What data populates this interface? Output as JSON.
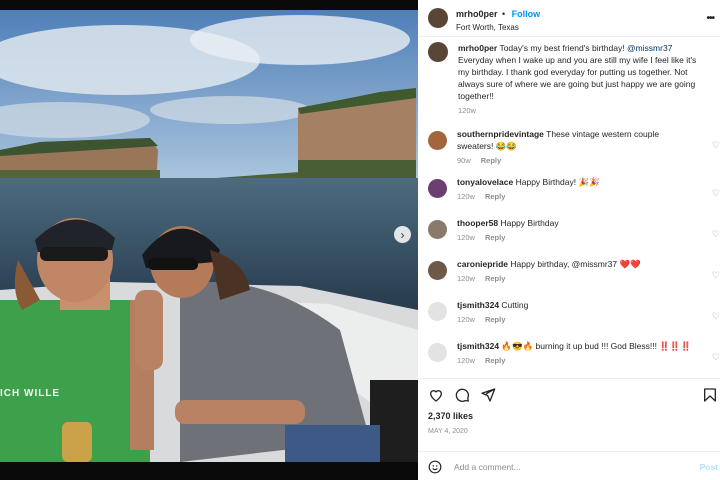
{
  "header": {
    "username": "mrho0per",
    "separator": "•",
    "follow_label": "Follow",
    "location": "Fort Worth, Texas",
    "more_icon": "more-horizontal-icon"
  },
  "caption": {
    "username": "mrho0per",
    "text": "Today's my best friend's birthday!",
    "mention": "@missmr37",
    "text2": "Everyday when I wake up and you are still my wife I feel like it's my birthday. I thank god everyday for putting us together. Not always sure of where we are going but just happy we are going together!!",
    "time": "120w"
  },
  "comments": [
    {
      "username": "southernpridevintage",
      "text": "These vintage western couple sweaters!",
      "emoji": "😂😂",
      "time": "90w",
      "reply": "Reply"
    },
    {
      "username": "tonyalovelace",
      "text": "Happy Birthday!",
      "emoji": "🎉🎉",
      "time": "120w",
      "reply": "Reply"
    },
    {
      "username": "thooper58",
      "text": "Happy Birthday",
      "emoji": "",
      "time": "120w",
      "reply": "Reply"
    },
    {
      "username": "caroniepride",
      "text": "Happy birthday, @missmr37",
      "emoji": "❤️❤️",
      "time": "120w",
      "reply": "Reply"
    },
    {
      "username": "tjsmith324",
      "text": "Cutting",
      "emoji": "",
      "time": "120w",
      "reply": "Reply"
    },
    {
      "username": "tjsmith324",
      "text": "🔥😎🔥 burning it up bud !!! God Bless!!!",
      "emoji": "‼️‼️‼️",
      "time": "120w",
      "reply": "Reply"
    }
  ],
  "actions": {
    "like_icon": "heart-icon",
    "comment_icon": "comment-icon",
    "share_icon": "share-icon",
    "save_icon": "bookmark-icon",
    "likes": "2,370 likes",
    "date": "MAY 4, 2020"
  },
  "add_comment": {
    "emoji_icon": "smiley-icon",
    "placeholder": "Add a comment...",
    "post_label": "Post"
  },
  "photo": {
    "description_icon": "next-arrow-icon",
    "next_glyph": "›",
    "shirt_text": "ICH WILLE"
  }
}
